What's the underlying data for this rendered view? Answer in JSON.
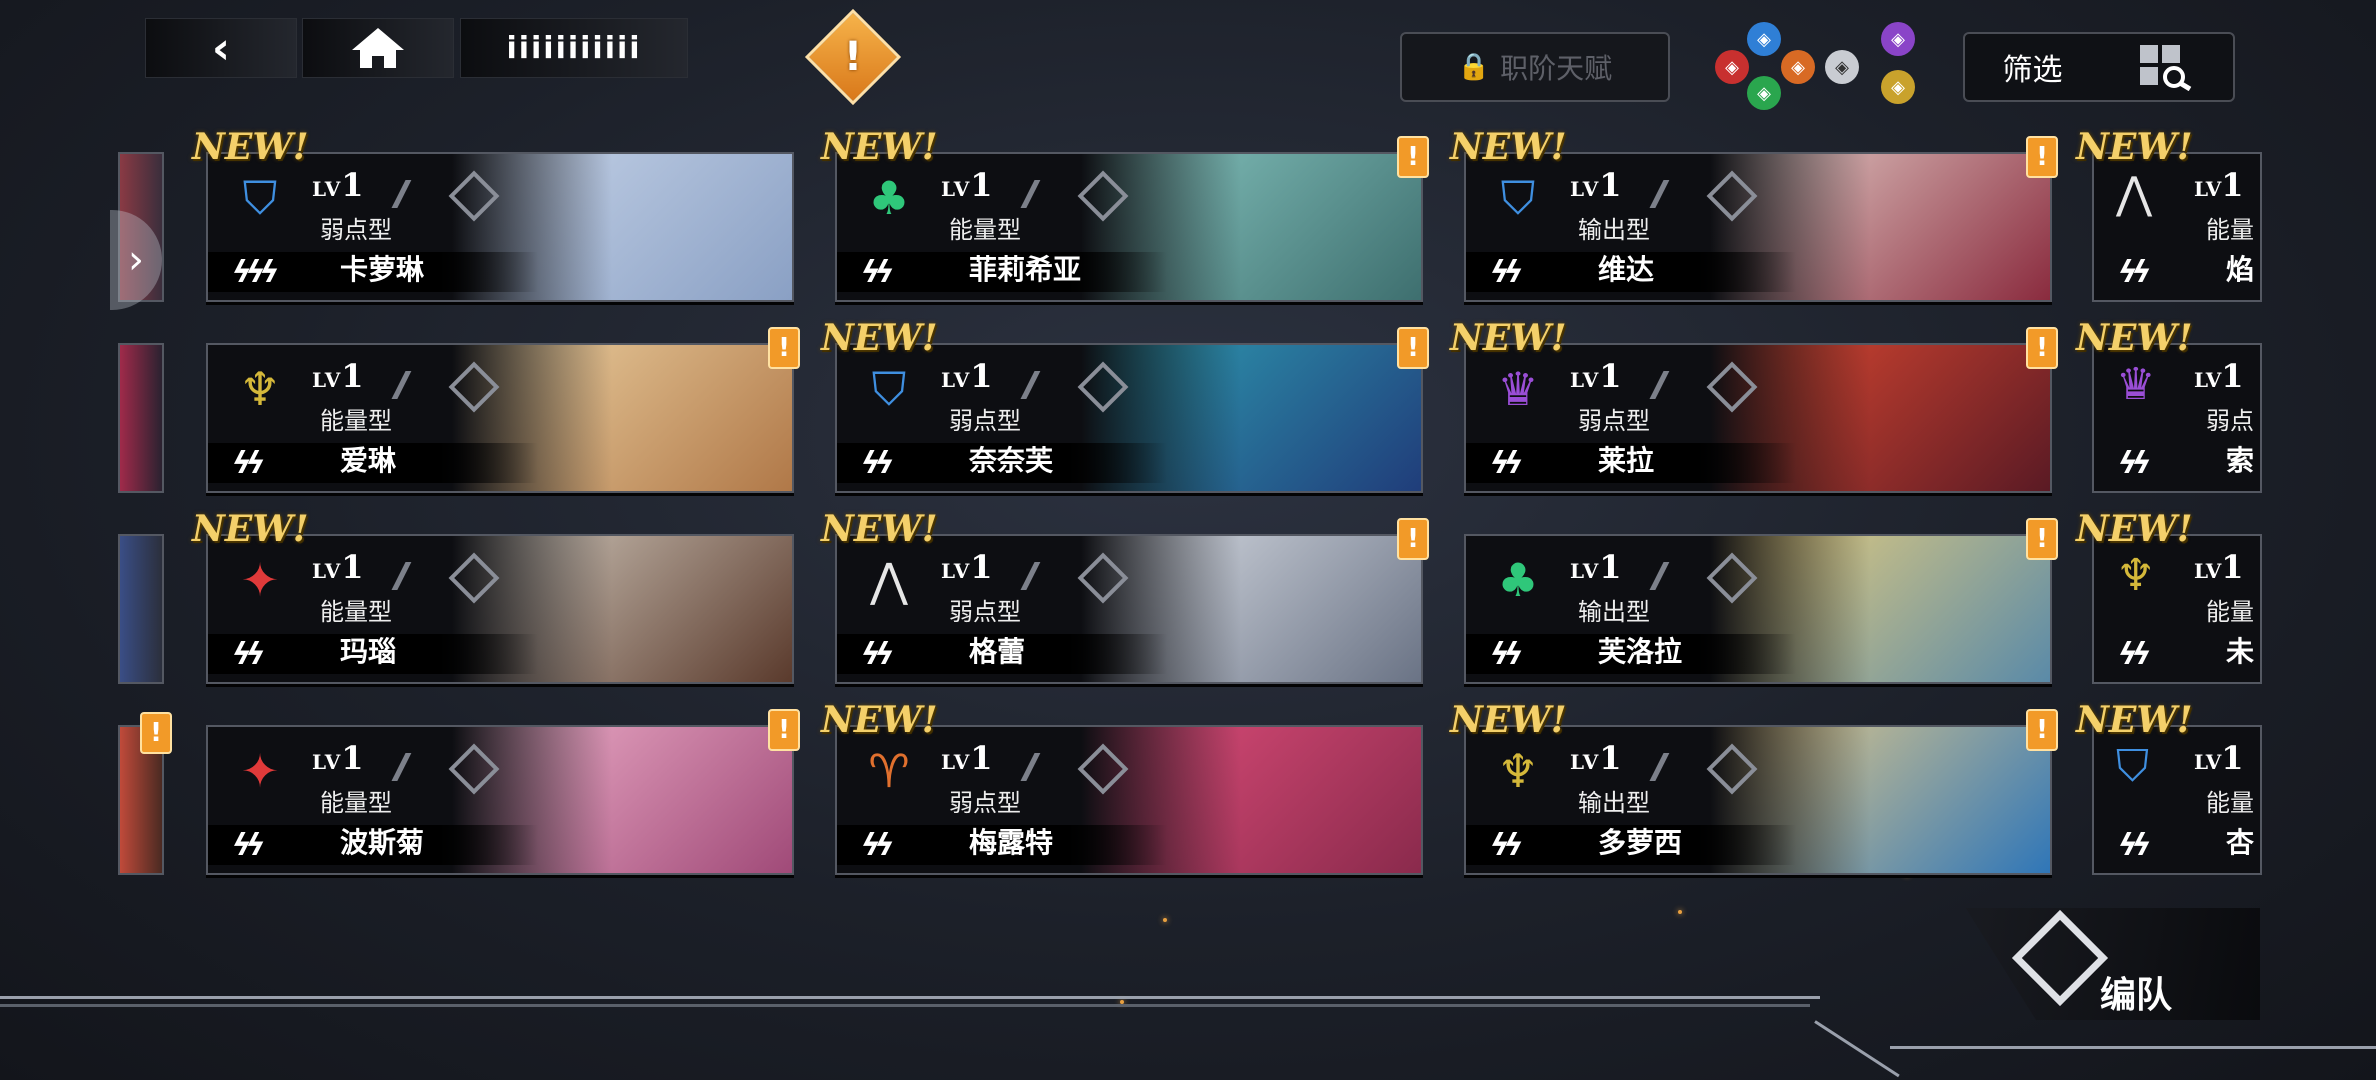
{
  "topbar": {
    "back_icon": "chevron-left-icon",
    "home_icon": "home-icon",
    "tab_label": "iiiiiiiiiii",
    "lock_label": "职阶天赋",
    "filter_label": "筛选"
  },
  "cards": [
    {
      "name": "卡萝琳",
      "role": "弱点型",
      "lv": "1",
      "new": true,
      "alert": false,
      "emblem": "shield-v",
      "emblemColor": "#3f8fe0",
      "stars": "ϟϟϟ",
      "art": [
        "#c9d6ea",
        "#8aa0c4"
      ]
    },
    {
      "name": "菲莉希亚",
      "role": "能量型",
      "lv": "1",
      "new": true,
      "alert": true,
      "emblem": "tree",
      "emblemColor": "#2fc77a",
      "stars": "ϟϟ",
      "art": [
        "#8ac9c3",
        "#3e6f6f"
      ]
    },
    {
      "name": "维达",
      "role": "输出型",
      "lv": "1",
      "new": true,
      "alert": true,
      "emblem": "shield-v",
      "emblemColor": "#3f8fe0",
      "stars": "ϟϟ",
      "art": [
        "#e8d6cf",
        "#8a2b3e"
      ]
    },
    {
      "name": "爱琳",
      "role": "能量型",
      "lv": "1",
      "new": false,
      "alert": true,
      "emblem": "cup",
      "emblemColor": "#d4b83a",
      "stars": "ϟϟ",
      "art": [
        "#f0d7a8",
        "#b07848"
      ]
    },
    {
      "name": "奈奈芙",
      "role": "弱点型",
      "lv": "1",
      "new": true,
      "alert": true,
      "emblem": "shield-v",
      "emblemColor": "#3f8fe0",
      "stars": "ϟϟ",
      "art": [
        "#2fa2b5",
        "#203d7a"
      ]
    },
    {
      "name": "莱拉",
      "role": "弱点型",
      "lv": "1",
      "new": true,
      "alert": true,
      "emblem": "crown",
      "emblemColor": "#9a4ed6",
      "stars": "ϟϟ",
      "art": [
        "#e24a32",
        "#5a1a24"
      ]
    },
    {
      "name": "玛瑙",
      "role": "能量型",
      "lv": "1",
      "new": true,
      "alert": false,
      "emblem": "wolf",
      "emblemColor": "#e03a3a",
      "stars": "ϟϟ",
      "art": [
        "#d9d2c6",
        "#5a3a2c"
      ]
    },
    {
      "name": "格蕾",
      "role": "弱点型",
      "lv": "1",
      "new": true,
      "alert": true,
      "emblem": "wings",
      "emblemColor": "#e6e6e6",
      "stars": "ϟϟ",
      "art": [
        "#dfe3ea",
        "#6a7385"
      ]
    },
    {
      "name": "芙洛拉",
      "role": "输出型",
      "lv": "1",
      "new": false,
      "alert": true,
      "emblem": "tree",
      "emblemColor": "#2fc77a",
      "stars": "ϟϟ",
      "art": [
        "#f1d27a",
        "#5a8aa8"
      ]
    },
    {
      "name": "波斯菊",
      "role": "能量型",
      "lv": "1",
      "new": false,
      "alert": true,
      "emblem": "wolf",
      "emblemColor": "#e03a3a",
      "stars": "ϟϟ",
      "art": [
        "#f3b6cf",
        "#a04a78"
      ]
    },
    {
      "name": "梅露特",
      "role": "弱点型",
      "lv": "1",
      "new": true,
      "alert": false,
      "emblem": "ram",
      "emblemColor": "#e0702e",
      "stars": "ϟϟ",
      "art": [
        "#e24f7c",
        "#8a2a4c"
      ]
    },
    {
      "name": "多萝西",
      "role": "输出型",
      "lv": "1",
      "new": true,
      "alert": true,
      "emblem": "cup",
      "emblemColor": "#d4b83a",
      "stars": "ϟϟ",
      "art": [
        "#f0cf86",
        "#2f76b8"
      ]
    }
  ],
  "right_partial": [
    {
      "name": "焰",
      "role": "能量",
      "emblem": "wings",
      "emblemColor": "#e6e6e6",
      "new": true
    },
    {
      "name": "索",
      "role": "弱点",
      "emblem": "crown",
      "emblemColor": "#9a4ed6",
      "new": true
    },
    {
      "name": "未",
      "role": "能量",
      "emblem": "cup",
      "emblemColor": "#d4b83a",
      "new": true
    },
    {
      "name": "杏",
      "role": "能量",
      "emblem": "shield-v",
      "emblemColor": "#3f8fe0",
      "new": true
    }
  ],
  "new_label": "NEW!",
  "lv_prefix": "LV",
  "team_button_label": "编队"
}
